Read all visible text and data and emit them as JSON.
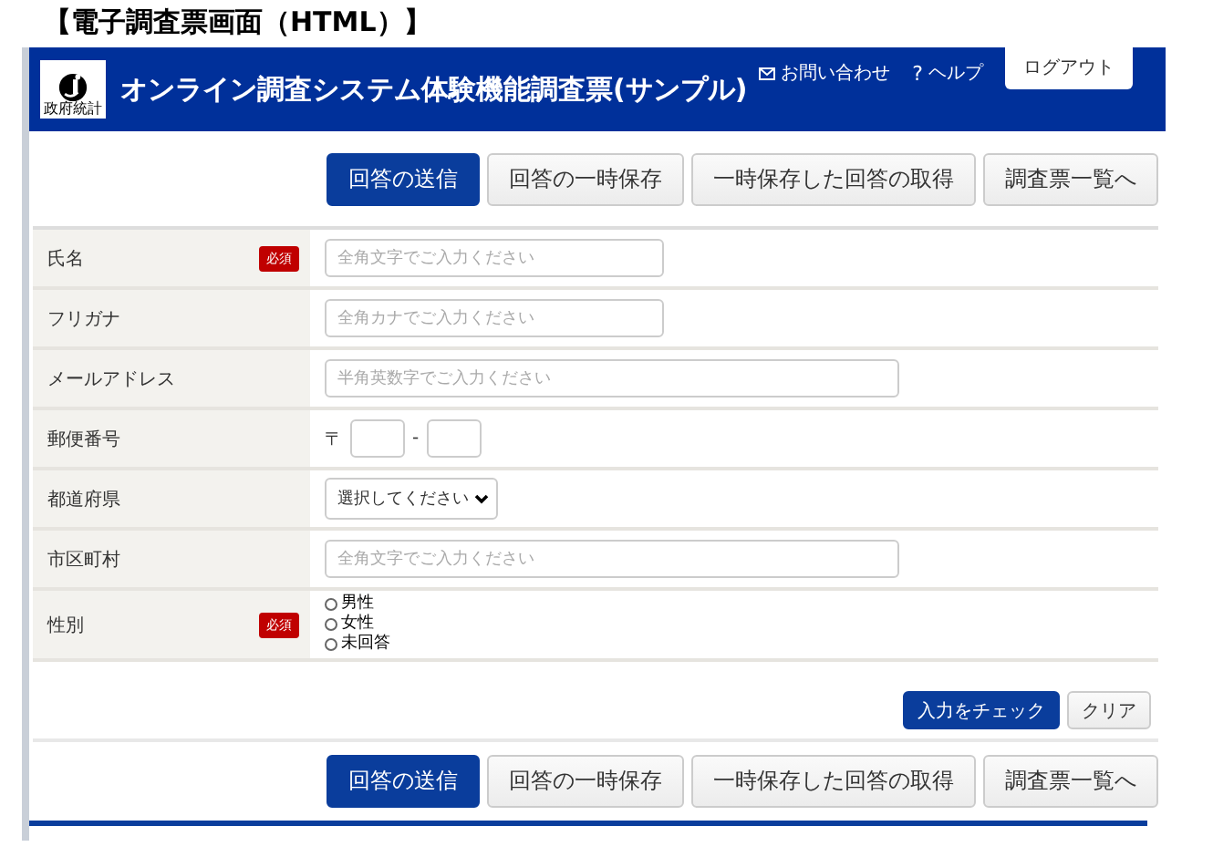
{
  "caption": "【電子調査票画面（HTML）】",
  "header": {
    "title": "オンライン調査システム体験機能調査票(サンプル)",
    "logo_text": "政府統計",
    "links": [
      {
        "kind": "mail",
        "label": "お問い合わせ"
      },
      {
        "kind": "help",
        "label": "ヘルプ",
        "icon": "?"
      }
    ],
    "logout": "ログアウト"
  },
  "top_buttons": [
    {
      "label": "回答の送信",
      "primary": true
    },
    {
      "label": "回答の一時保存",
      "primary": false
    },
    {
      "label": "一時保存した回答の取得",
      "primary": false
    },
    {
      "label": "調査票一覧へ",
      "primary": false
    }
  ],
  "fields": [
    {
      "kind": "text",
      "label": "氏名",
      "badge": "必須",
      "placeholder": "全角文字でご入力ください",
      "wide": false
    },
    {
      "kind": "text",
      "label": "フリガナ",
      "placeholder": "全角カナでご入力ください",
      "wide": false
    },
    {
      "kind": "text",
      "label": "メールアドレス",
      "placeholder": "半角英数字でご入力ください",
      "wide": true
    },
    {
      "kind": "postal",
      "label": "郵便番号",
      "mark": "〒",
      "separator": "-"
    },
    {
      "kind": "select",
      "label": "都道府県",
      "value": "選択してください"
    },
    {
      "kind": "text",
      "label": "市区町村",
      "placeholder": "全角文字でご入力ください",
      "wide": true
    },
    {
      "kind": "radio",
      "label": "性別",
      "badge": "必須",
      "options": [
        {
          "label": "男性",
          "selected": false
        },
        {
          "label": "女性",
          "selected": false
        },
        {
          "label": "未回答",
          "selected": false
        }
      ]
    }
  ],
  "check_buttons": [
    {
      "label": "入力をチェック",
      "primary": true
    },
    {
      "label": "クリア",
      "primary": false
    }
  ],
  "bottom_buttons": [
    {
      "label": "回答の送信",
      "primary": true
    },
    {
      "label": "回答の一時保存",
      "primary": false
    },
    {
      "label": "一時保存した回答の取得",
      "primary": false
    },
    {
      "label": "調査票一覧へ",
      "primary": false
    }
  ]
}
